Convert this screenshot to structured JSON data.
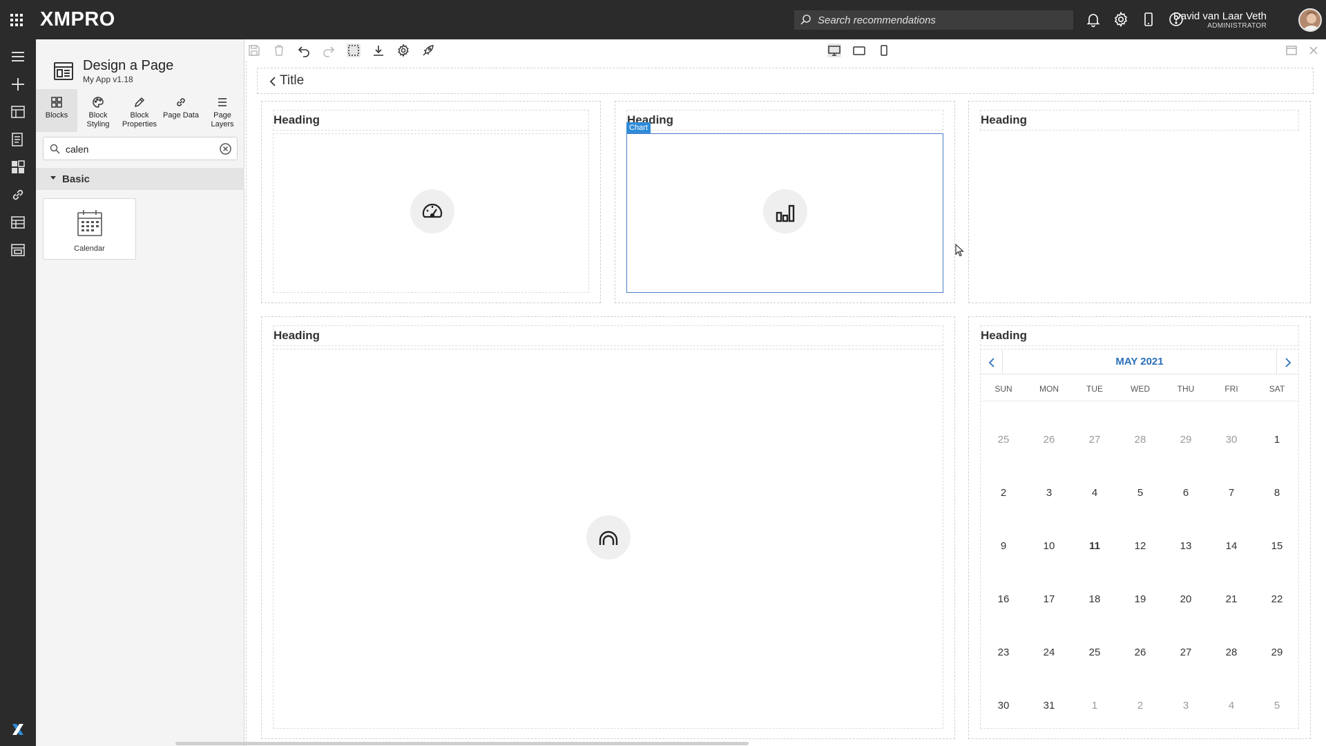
{
  "topbar": {
    "logo": "XMPRO",
    "search_placeholder": "Search recommendations",
    "user_name": "David van Laar Veth",
    "user_role": "ADMINISTRATOR"
  },
  "panel": {
    "title": "Design a Page",
    "subtitle": "My App v1.18",
    "tabs": [
      {
        "label": "Blocks"
      },
      {
        "label": "Block Styling"
      },
      {
        "label": "Block Properties"
      },
      {
        "label": "Page Data"
      },
      {
        "label": "Page Layers"
      }
    ],
    "search_value": "calen",
    "group": "Basic",
    "block_label": "Calendar"
  },
  "canvas": {
    "title": "Title",
    "headings": [
      "Heading",
      "Heading",
      "Heading",
      "Heading",
      "Heading"
    ],
    "chart_tag": "Chart"
  },
  "calendar": {
    "month": "MAY 2021",
    "days_of_week": [
      "SUN",
      "MON",
      "TUE",
      "WED",
      "THU",
      "FRI",
      "SAT"
    ],
    "weeks": [
      [
        "25",
        "26",
        "27",
        "28",
        "29",
        "30",
        "1"
      ],
      [
        "2",
        "3",
        "4",
        "5",
        "6",
        "7",
        "8"
      ],
      [
        "9",
        "10",
        "11",
        "12",
        "13",
        "14",
        "15"
      ],
      [
        "16",
        "17",
        "18",
        "19",
        "20",
        "21",
        "22"
      ],
      [
        "23",
        "24",
        "25",
        "26",
        "27",
        "28",
        "29"
      ],
      [
        "30",
        "31",
        "1",
        "2",
        "3",
        "4",
        "5"
      ]
    ],
    "today": "11",
    "accent_color": "#2a70b8"
  },
  "colors": {
    "topbar": "#2b2b2b",
    "selection": "#4a7dc4",
    "chart_tag": "#2f8bd8"
  }
}
